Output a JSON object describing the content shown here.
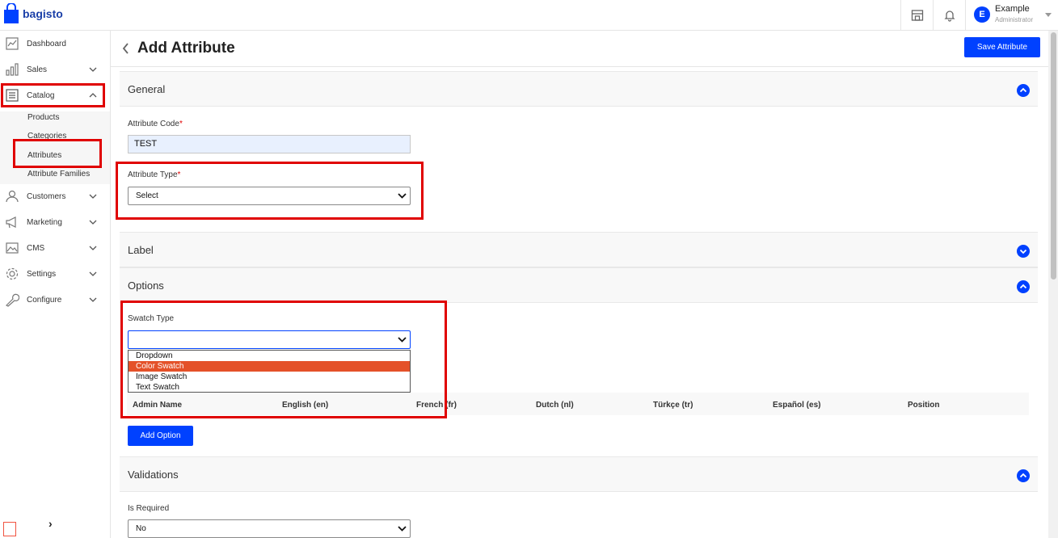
{
  "app": {
    "logo_text": "bagisto",
    "brand_color": "#0041ff"
  },
  "topbar": {
    "icons": [
      "store-icon",
      "bell-icon"
    ],
    "user": {
      "initial": "E",
      "name": "Example",
      "role": "Administrator"
    }
  },
  "sidebar": {
    "items": [
      {
        "label": "Dashboard",
        "icon": "dashboard-icon"
      },
      {
        "label": "Sales",
        "icon": "sales-icon"
      },
      {
        "label": "Catalog",
        "icon": "catalog-icon"
      },
      {
        "label": "Customers",
        "icon": "customers-icon"
      },
      {
        "label": "Marketing",
        "icon": "marketing-icon"
      },
      {
        "label": "CMS",
        "icon": "cms-icon"
      },
      {
        "label": "Settings",
        "icon": "settings-icon"
      },
      {
        "label": "Configure",
        "icon": "configure-icon"
      }
    ],
    "catalog_sub": [
      "Products",
      "Categories",
      "Attributes",
      "Attribute Families"
    ],
    "collapse_label": "›"
  },
  "page": {
    "title": "Add Attribute",
    "save_label": "Save Attribute"
  },
  "general": {
    "title": "General",
    "code_label": "Attribute Code",
    "code_value": "TEST",
    "type_label": "Attribute Type",
    "type_value": "Select",
    "required_mark": "*"
  },
  "label_section": {
    "title": "Label"
  },
  "options": {
    "title": "Options",
    "swatch_label": "Swatch Type",
    "swatch_value": "",
    "swatch_options": [
      "Dropdown",
      "Color Swatch",
      "Image Swatch",
      "Text Swatch"
    ],
    "highlighted_option": "Color Swatch",
    "columns": [
      "Admin Name",
      "English (en)",
      "French (fr)",
      "Dutch (nl)",
      "Türkçe (tr)",
      "Español (es)",
      "Position"
    ],
    "add_label": "Add Option"
  },
  "validations": {
    "title": "Validations",
    "required_label": "Is Required",
    "required_value": "No"
  },
  "colors": {
    "annotation_red": "#e00000",
    "highlight": "#e45129"
  }
}
